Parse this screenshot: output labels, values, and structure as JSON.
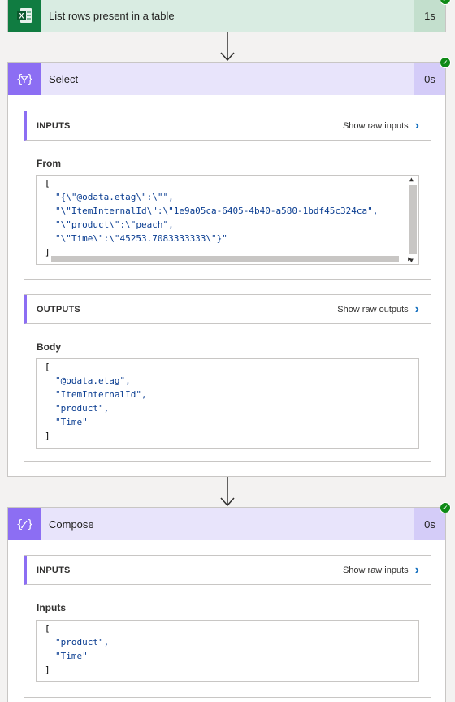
{
  "list_rows": {
    "title": "List rows present in a table",
    "duration": "1s",
    "icon": "excel-icon"
  },
  "select": {
    "title": "Select",
    "duration": "0s",
    "icon": "select-data-icon",
    "inputs": {
      "section_label": "INPUTS",
      "raw_link": "Show raw inputs",
      "field_label": "From",
      "open_bracket": "[",
      "lines": [
        "\"{\\\"@odata.etag\\\":\\\"\",",
        "\"\\\"ItemInternalId\\\":\\\"1e9a05ca-6405-4b40-a580-1bdf45c324ca\",",
        "\"\\\"product\\\":\\\"peach\",",
        "\"\\\"Time\\\":\\\"45253.7083333333\\\"}\""
      ],
      "close_bracket": "]"
    },
    "outputs": {
      "section_label": "OUTPUTS",
      "raw_link": "Show raw outputs",
      "field_label": "Body",
      "open_bracket": "[",
      "lines": [
        "\"@odata.etag\",",
        "\"ItemInternalId\",",
        "\"product\",",
        "\"Time\""
      ],
      "close_bracket": "]"
    }
  },
  "compose": {
    "title": "Compose",
    "duration": "0s",
    "icon": "compose-icon",
    "inputs": {
      "section_label": "INPUTS",
      "raw_link": "Show raw inputs",
      "field_label": "Inputs",
      "open_bracket": "[",
      "lines": [
        "\"product\",",
        "\"Time\""
      ],
      "close_bracket": "]"
    }
  },
  "colors": {
    "excel": "#107c41",
    "action_accent": "#8c6ef3",
    "success": "#0e8a16",
    "link": "#0f6cbd"
  }
}
